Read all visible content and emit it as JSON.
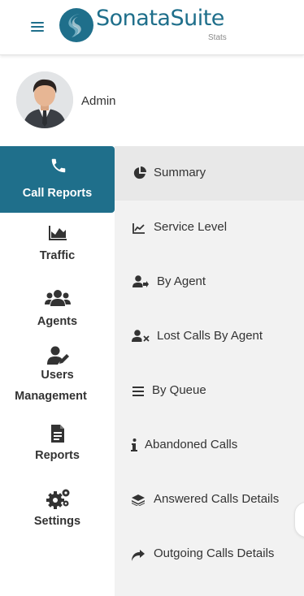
{
  "header": {
    "brand": "SonataSuite",
    "brand_sub": "Stats",
    "icons": {
      "menu": "hamburger-icon",
      "logo": "sonatasuite-logo-icon"
    }
  },
  "user": {
    "name": "Admin",
    "avatar": "user-avatar"
  },
  "nav": {
    "items": [
      {
        "label": "Call Reports",
        "icon": "phone-icon",
        "active": true
      },
      {
        "label": "Traffic",
        "icon": "area-chart-icon"
      },
      {
        "label": "Agents",
        "icon": "users-icon"
      },
      {
        "label": "Users",
        "label2": "Management",
        "icon": "user-edit-icon"
      },
      {
        "label": "Reports",
        "icon": "document-icon"
      },
      {
        "label": "Settings",
        "icon": "gears-icon"
      }
    ]
  },
  "submenu": {
    "items": [
      {
        "label": "Summary",
        "icon": "pie-chart-icon",
        "active": true
      },
      {
        "label": "Service Level",
        "icon": "line-chart-icon"
      },
      {
        "label": "By Agent",
        "icon": "user-arrow-icon"
      },
      {
        "label": "Lost Calls By Agent",
        "icon": "user-times-icon"
      },
      {
        "label": "By Queue",
        "icon": "list-icon"
      },
      {
        "label": "Abandoned Calls",
        "icon": "info-icon"
      },
      {
        "label": "Answered Calls Details",
        "icon": "layers-icon"
      },
      {
        "label": "Outgoing Calls Details",
        "icon": "share-arrow-icon"
      }
    ]
  },
  "colors": {
    "primary": "#1f6f8b",
    "submenu_bg": "#f2f2f2",
    "text": "#333333"
  }
}
